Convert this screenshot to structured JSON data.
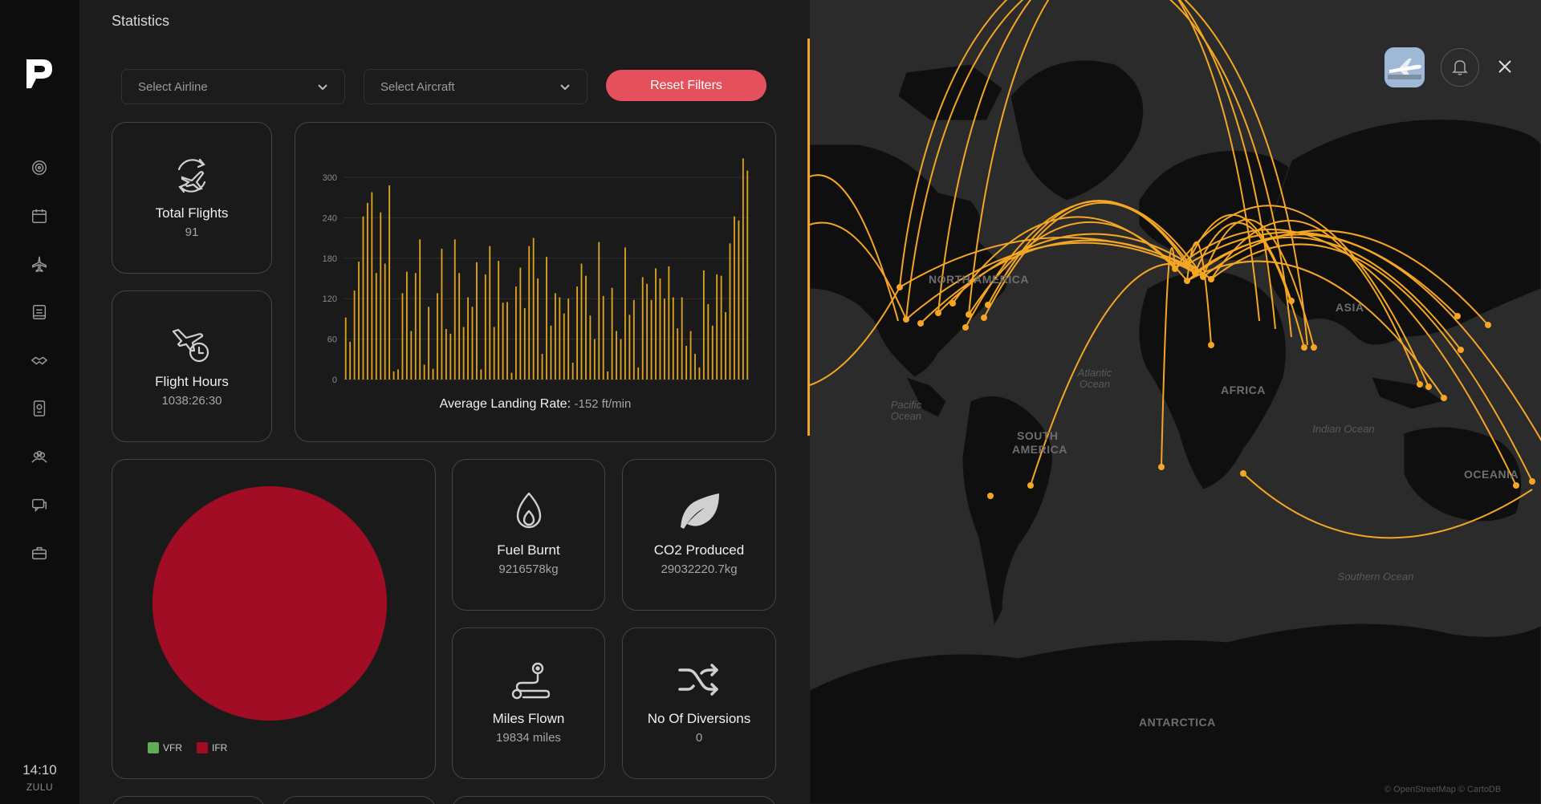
{
  "app": {
    "title": "Statistics"
  },
  "sidebar": {
    "items": [
      {
        "name": "radar"
      },
      {
        "name": "calendar"
      },
      {
        "name": "plane"
      },
      {
        "name": "logbook"
      },
      {
        "name": "handshake"
      },
      {
        "name": "passport"
      },
      {
        "name": "community"
      },
      {
        "name": "chat"
      },
      {
        "name": "briefcase"
      }
    ],
    "clock": {
      "time": "14:10",
      "zone": "ZULU"
    }
  },
  "filters": {
    "airline_placeholder": "Select Airline",
    "aircraft_placeholder": "Select Aircraft",
    "reset_label": "Reset Filters"
  },
  "stats": {
    "total_flights": {
      "label": "Total Flights",
      "value": "91"
    },
    "flight_hours": {
      "label": "Flight Hours",
      "value": "1038:26:30"
    },
    "fuel_burnt": {
      "label": "Fuel Burnt",
      "value": "9216578kg"
    },
    "co2": {
      "label": "CO2 Produced",
      "value": "29032220.7kg"
    },
    "miles": {
      "label": "Miles Flown",
      "value": "19834 miles"
    },
    "diversions": {
      "label": "No Of Diversions",
      "value": "0"
    }
  },
  "landing_rate": {
    "label": "Average Landing Rate:",
    "value": "-152 ft/min"
  },
  "chart_data": [
    {
      "type": "bar",
      "ylim": [
        0,
        300
      ],
      "yticks": [
        "0",
        "60",
        "120",
        "180",
        "240",
        "300"
      ],
      "color": "#e0a520",
      "values": [
        92,
        56,
        132,
        175,
        242,
        262,
        278,
        158,
        248,
        172,
        288,
        12,
        15,
        128,
        160,
        72,
        158,
        208,
        22,
        108,
        16,
        128,
        194,
        75,
        68,
        208,
        158,
        78,
        122,
        108,
        174,
        15,
        156,
        198,
        78,
        176,
        114,
        115,
        10,
        138,
        166,
        106,
        198,
        210,
        150,
        38,
        182,
        80,
        128,
        122,
        98,
        120,
        25,
        138,
        172,
        154,
        95,
        60,
        204,
        124,
        12,
        136,
        72,
        60,
        196,
        96,
        118,
        18,
        152,
        142,
        118,
        165,
        150,
        120,
        168,
        122,
        76,
        122,
        50,
        72,
        38,
        18,
        162,
        112,
        80,
        156,
        154,
        100,
        202,
        242,
        236,
        328,
        310
      ],
      "xlabel": "",
      "ylabel": ""
    },
    {
      "type": "pie",
      "categories": [
        "VFR",
        "IFR"
      ],
      "values": [
        0,
        91
      ],
      "colors": [
        "#5fad56",
        "#a10c25"
      ]
    }
  ],
  "map": {
    "labels": {
      "north_america": "NORTH AMERICA",
      "south_america_1": "SOUTH",
      "south_america_2": "AMERICA",
      "africa": "AFRICA",
      "asia": "ASIA",
      "oceania": "OCEANIA",
      "antarctica": "ANTARCTICA",
      "pacific": "Pacific Ocean",
      "atlantic": "Atlantic Ocean",
      "indian": "Indian Ocean",
      "southern": "Southern Ocean"
    },
    "attribution": "© OpenStreetMap © CartoDB",
    "route_color": "#f5a623"
  }
}
